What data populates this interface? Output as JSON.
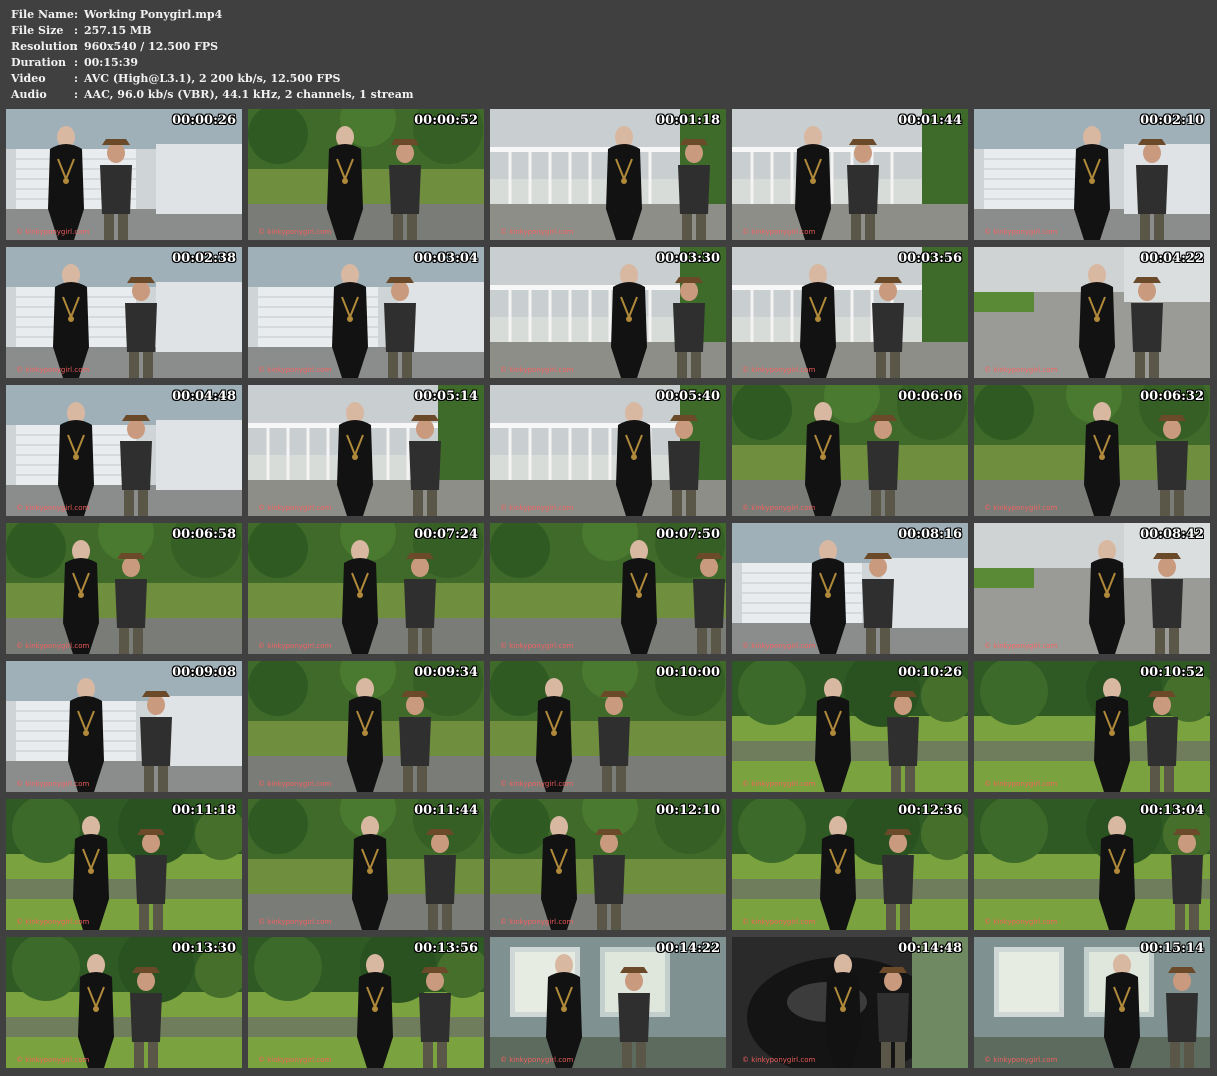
{
  "info": [
    {
      "key": "File Name",
      "sep": ":",
      "value": "Working Ponygirl.mp4"
    },
    {
      "key": "File Size",
      "sep": ":",
      "value": "257.15 MB"
    },
    {
      "key": "Resolution",
      "sep": ":",
      "value": "960x540 / 12.500 FPS"
    },
    {
      "key": "Duration",
      "sep": ":",
      "value": "00:15:39"
    },
    {
      "key": "Video",
      "sep": ":",
      "value": "AVC (High@L3.1), 2 200 kb/s, 12.500 FPS"
    },
    {
      "key": "Audio",
      "sep": ":",
      "value": "AAC, 96.0 kb/s (VBR), 44.1 kHz, 2 channels, 1 stream"
    }
  ],
  "watermark": "© kinkyponygirl.com",
  "thumbnails": [
    {
      "time": "00:00:26",
      "scene": "garage"
    },
    {
      "time": "00:00:52",
      "scene": "trees"
    },
    {
      "time": "00:01:18",
      "scene": "porch"
    },
    {
      "time": "00:01:44",
      "scene": "porch"
    },
    {
      "time": "00:02:10",
      "scene": "garage"
    },
    {
      "time": "00:02:38",
      "scene": "garage"
    },
    {
      "time": "00:03:04",
      "scene": "garage"
    },
    {
      "time": "00:03:30",
      "scene": "porch"
    },
    {
      "time": "00:03:56",
      "scene": "porch"
    },
    {
      "time": "00:04:22",
      "scene": "driveway"
    },
    {
      "time": "00:04:48",
      "scene": "garage"
    },
    {
      "time": "00:05:14",
      "scene": "porch"
    },
    {
      "time": "00:05:40",
      "scene": "porch"
    },
    {
      "time": "00:06:06",
      "scene": "trees"
    },
    {
      "time": "00:06:32",
      "scene": "trees"
    },
    {
      "time": "00:06:58",
      "scene": "trees"
    },
    {
      "time": "00:07:24",
      "scene": "trees"
    },
    {
      "time": "00:07:50",
      "scene": "trees"
    },
    {
      "time": "00:08:16",
      "scene": "garage"
    },
    {
      "time": "00:08:42",
      "scene": "driveway"
    },
    {
      "time": "00:09:08",
      "scene": "garage"
    },
    {
      "time": "00:09:34",
      "scene": "trees"
    },
    {
      "time": "00:10:00",
      "scene": "trees"
    },
    {
      "time": "00:10:26",
      "scene": "lawn"
    },
    {
      "time": "00:10:52",
      "scene": "lawn"
    },
    {
      "time": "00:11:18",
      "scene": "lawn"
    },
    {
      "time": "00:11:44",
      "scene": "trees"
    },
    {
      "time": "00:12:10",
      "scene": "trees"
    },
    {
      "time": "00:12:36",
      "scene": "lawn"
    },
    {
      "time": "00:13:04",
      "scene": "lawn"
    },
    {
      "time": "00:13:30",
      "scene": "lawn"
    },
    {
      "time": "00:13:56",
      "scene": "lawn"
    },
    {
      "time": "00:14:22",
      "scene": "house"
    },
    {
      "time": "00:14:48",
      "scene": "closeup"
    },
    {
      "time": "00:15:14",
      "scene": "house"
    }
  ]
}
